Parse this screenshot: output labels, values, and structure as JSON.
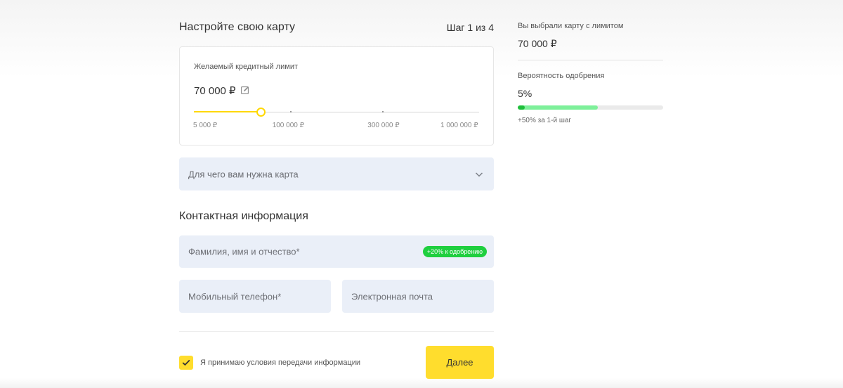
{
  "form": {
    "title": "Настройте свою карту",
    "step": "Шаг 1 из 4",
    "limit": {
      "label": "Желаемый кредитный лимит",
      "value": "70 000 ₽",
      "slider_fraction": 0.235,
      "ticks": [
        {
          "label": "5 000 ₽",
          "pos": 0.0
        },
        {
          "label": "100 000 ₽",
          "pos": 0.333
        },
        {
          "label": "300 000 ₽",
          "pos": 0.667
        },
        {
          "label": "1 000 000 ₽",
          "pos": 1.0
        }
      ]
    },
    "purpose": {
      "placeholder": "Для чего вам нужна карта"
    },
    "contact": {
      "title": "Контактная информация",
      "full_name": {
        "placeholder": "Фамилия, имя и отчество*",
        "badge": "+20% к одобрению"
      },
      "phone": {
        "placeholder": "Мобильный телефон*"
      },
      "email": {
        "placeholder": "Электронная почта"
      }
    },
    "consent": {
      "label": "Я принимаю условия передачи информации",
      "checked": true
    },
    "next_label": "Далее"
  },
  "summary": {
    "limit_label": "Вы выбрали карту с лимитом",
    "limit_value": "70 000 ₽",
    "probability_label": "Вероятность одобрения",
    "probability_value": "5%",
    "probability_fraction": 0.05,
    "bonus_fraction": 0.5,
    "bonus_note": "+50% за 1-й шаг"
  },
  "colors": {
    "accent_yellow": "#ffdd2d",
    "field_bg": "#eaeff8",
    "success_green": "#1fcf3f",
    "bonus_green": "#7ef09a"
  },
  "icons": {
    "edit": "edit-icon",
    "chevron": "chevron-down-icon",
    "check": "check-icon"
  }
}
